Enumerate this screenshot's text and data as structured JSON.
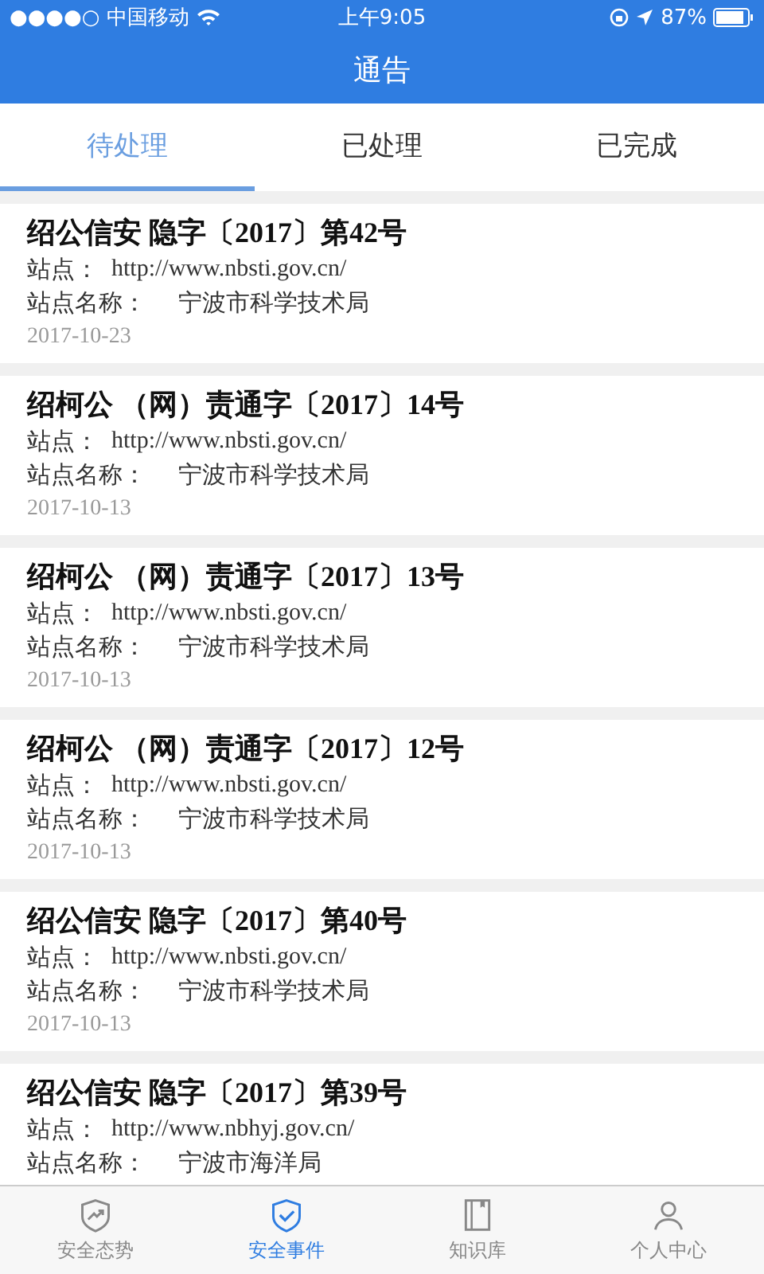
{
  "status_bar": {
    "carrier": "●●●●○ 中国移动",
    "time": "上午9:05",
    "battery": "87%"
  },
  "header": {
    "title": "通告"
  },
  "tabs": [
    {
      "label": "待处理",
      "selected": true
    },
    {
      "label": "已处理",
      "selected": false
    },
    {
      "label": "已完成",
      "selected": false
    }
  ],
  "notices": [
    {
      "title": "绍公信安 隐字〔2017〕第42号",
      "site_label": "站点：",
      "site": "http://www.nbsti.gov.cn/",
      "name_label": "站点名称：",
      "name": "宁波市科学技术局",
      "date": "2017-10-23"
    },
    {
      "title": "绍柯公 （网）责通字〔2017〕14号",
      "site_label": "站点：",
      "site": "http://www.nbsti.gov.cn/",
      "name_label": "站点名称：",
      "name": "宁波市科学技术局",
      "date": "2017-10-13"
    },
    {
      "title": "绍柯公 （网）责通字〔2017〕13号",
      "site_label": "站点：",
      "site": "http://www.nbsti.gov.cn/",
      "name_label": "站点名称：",
      "name": "宁波市科学技术局",
      "date": "2017-10-13"
    },
    {
      "title": "绍柯公 （网）责通字〔2017〕12号",
      "site_label": "站点：",
      "site": "http://www.nbsti.gov.cn/",
      "name_label": "站点名称：",
      "name": "宁波市科学技术局",
      "date": "2017-10-13"
    },
    {
      "title": "绍公信安 隐字〔2017〕第40号",
      "site_label": "站点：",
      "site": "http://www.nbsti.gov.cn/",
      "name_label": "站点名称：",
      "name": "宁波市科学技术局",
      "date": "2017-10-13"
    },
    {
      "title": "绍公信安 隐字〔2017〕第39号",
      "site_label": "站点：",
      "site": "http://www.nbhyj.gov.cn/",
      "name_label": "站点名称：",
      "name": "宁波市海洋局"
    }
  ],
  "bottom_nav": [
    {
      "label": "安全态势",
      "selected": false
    },
    {
      "label": "安全事件",
      "selected": true
    },
    {
      "label": "知识库",
      "selected": false
    },
    {
      "label": "个人中心",
      "selected": false
    }
  ]
}
